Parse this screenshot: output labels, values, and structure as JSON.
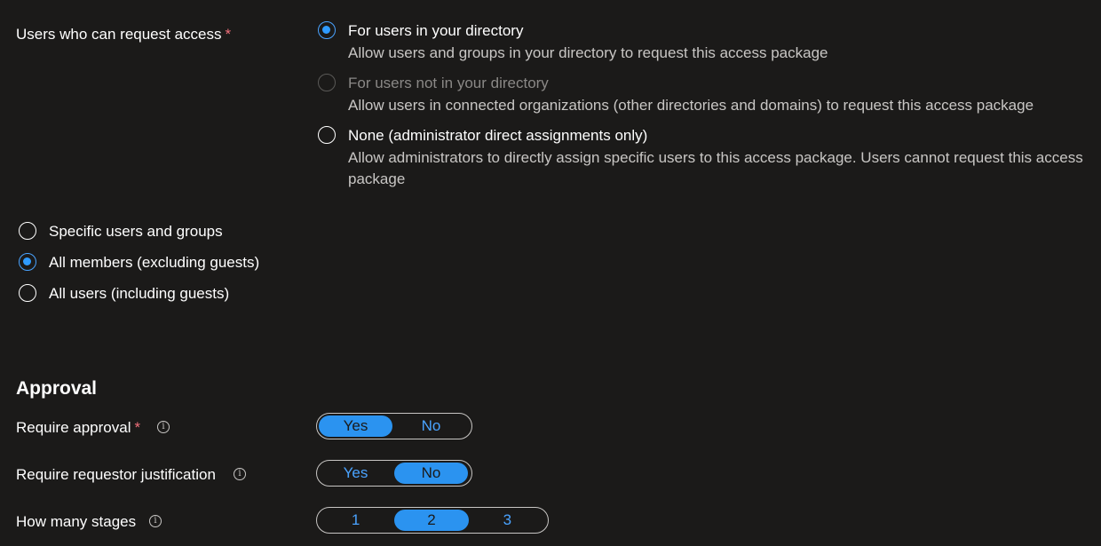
{
  "request_access": {
    "label": "Users who can request access",
    "required_mark": "*",
    "options": [
      {
        "title": "For users in your directory",
        "description": "Allow users and groups in your directory to request this access package",
        "checked": true,
        "disabled": false
      },
      {
        "title": "For users not in your directory",
        "description": "Allow users in connected organizations (other directories and domains) to request this access package",
        "checked": false,
        "disabled": true
      },
      {
        "title": "None (administrator direct assignments only)",
        "description": "Allow administrators to directly assign specific users to this access package. Users cannot request this access package",
        "checked": false,
        "disabled": false
      }
    ]
  },
  "scope": {
    "options": [
      {
        "label": "Specific users and groups",
        "checked": false
      },
      {
        "label": "All members (excluding guests)",
        "checked": true
      },
      {
        "label": "All users (including guests)",
        "checked": false
      }
    ]
  },
  "approval": {
    "heading": "Approval",
    "require_approval": {
      "label": "Require approval",
      "required_mark": "*",
      "info_icon": "info-icon",
      "options": [
        "Yes",
        "No"
      ],
      "selected": "Yes"
    },
    "require_justification": {
      "label": "Require requestor justification",
      "info_icon": "info-icon",
      "options": [
        "Yes",
        "No"
      ],
      "selected": "No"
    },
    "stages": {
      "label": "How many stages",
      "info_icon": "info-icon",
      "options": [
        "1",
        "2",
        "3"
      ],
      "selected": "2"
    }
  },
  "colors": {
    "background": "#1b1a19",
    "accent": "#2b93f0",
    "required": "#f1707b"
  }
}
